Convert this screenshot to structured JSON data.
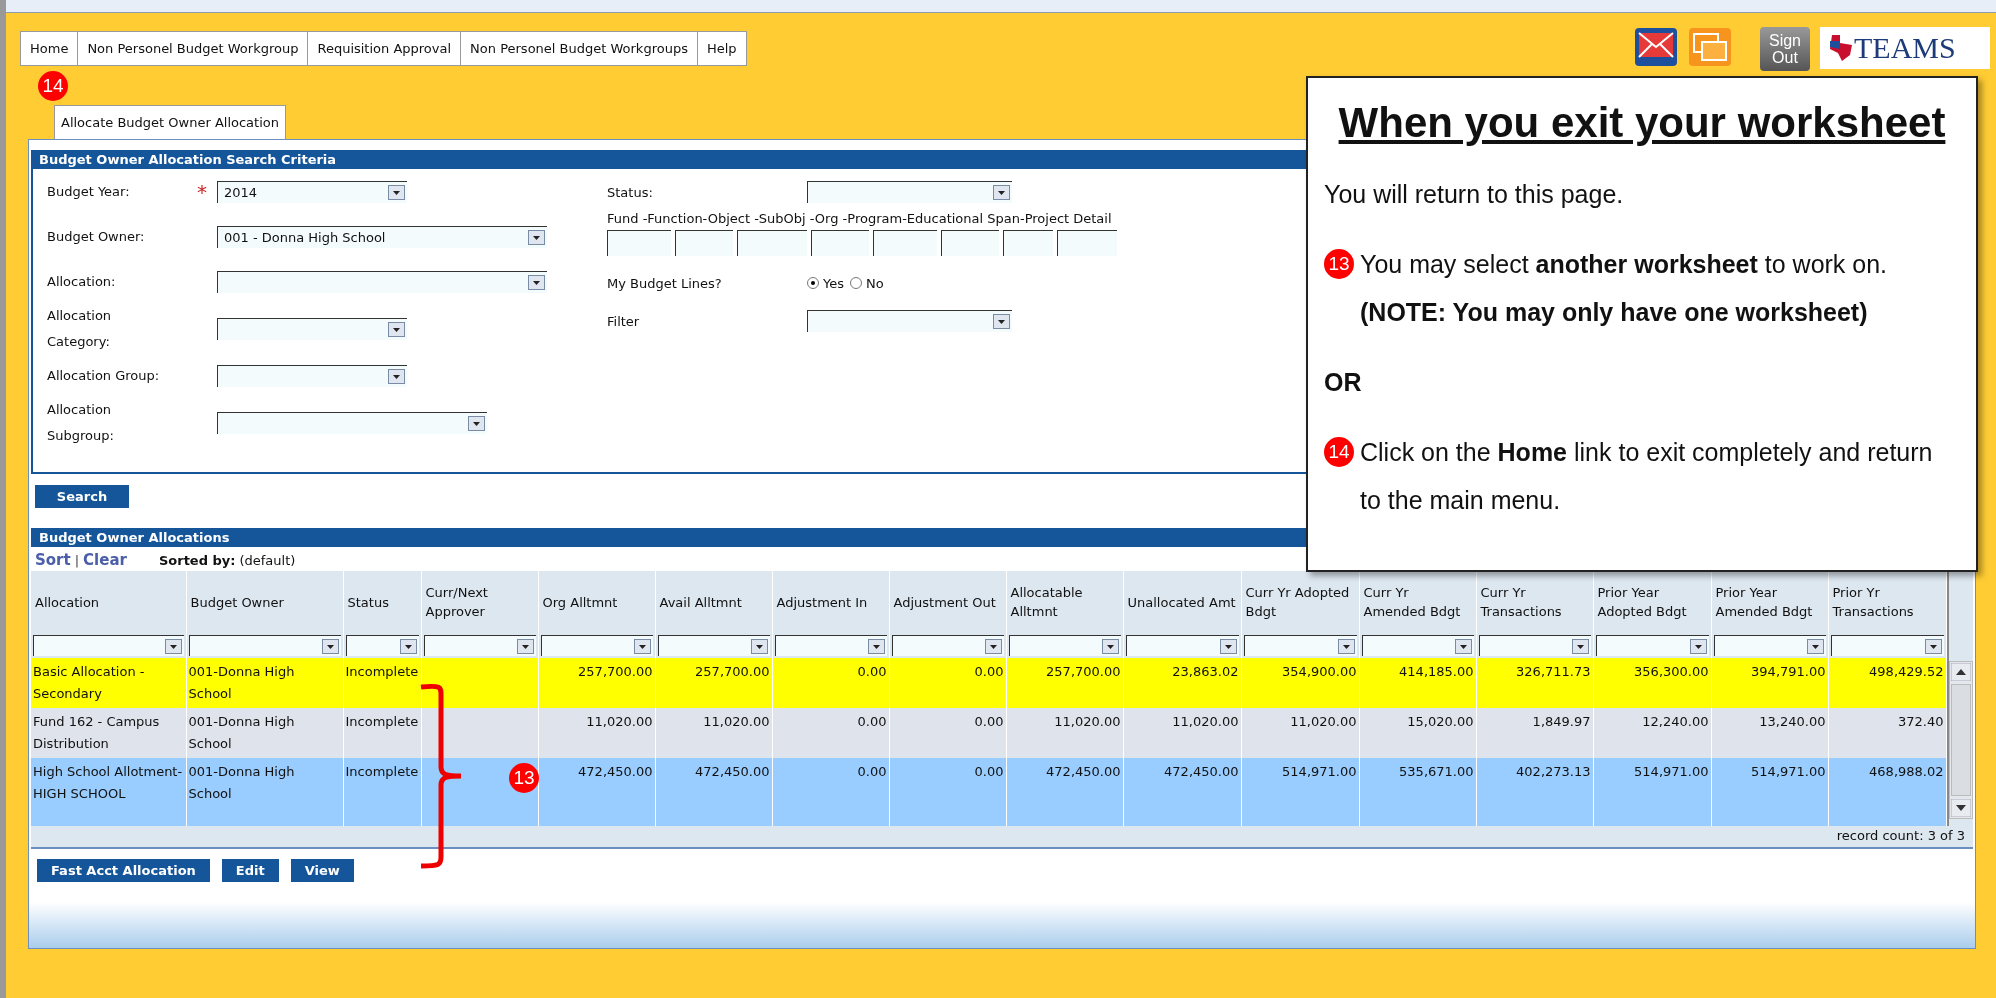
{
  "menu": [
    {
      "label": "Home"
    },
    {
      "label": "Non Personel Budget Workgroup"
    },
    {
      "label": "Requisition Approval"
    },
    {
      "label": "Non Personel Budget Workgroups"
    },
    {
      "label": "Help"
    }
  ],
  "menu_badge": "14",
  "header_buttons": {
    "sign_out": "Sign Out",
    "logo": "TEAMS"
  },
  "tabs": [
    {
      "label": "Allocate Budget Owner Allocation",
      "selected": true
    }
  ],
  "search_criteria": {
    "title": "Budget Owner Allocation Search Criteria",
    "left_fields": [
      {
        "label": "Budget Year:",
        "required": true,
        "value": "2014"
      },
      {
        "label": "Budget Owner:",
        "required": false,
        "value": "001 - Donna High School"
      },
      {
        "label": "Allocation:",
        "required": false
      },
      {
        "label": "Allocation Category:",
        "required": false
      },
      {
        "label": "Allocation Group:",
        "required": false
      },
      {
        "label": "Allocation Subgroup:",
        "required": false
      }
    ],
    "required_mark": "*",
    "status_label": "Status:",
    "account_label": "Fund -Function-Object -SubObj -Org -Program-Educational Span-Project Detail",
    "my_budget_lines": {
      "label": "My Budget Lines?",
      "options": [
        {
          "label": "Yes",
          "selected": true
        },
        {
          "label": "No",
          "selected": false
        }
      ]
    },
    "filter_label": "Filter",
    "search_button": "Search"
  },
  "allocations": {
    "title": "Budget Owner Allocations",
    "sort": "Sort",
    "separator": "|",
    "clear": "Clear",
    "sorted_by_label": "Sorted by:",
    "sorted_by_value": "(default)",
    "columns": [
      "Allocation",
      "Budget Owner",
      "Status",
      "Curr/Next Approver",
      "Org Alltmnt",
      "Avail Alltmnt",
      "Adjustment In",
      "Adjustment Out",
      "Allocatable Alltmnt",
      "Unallocated Amt",
      "Curr Yr Adopted Bdgt",
      "Curr Yr Amended Bdgt",
      "Curr Yr Transactions",
      "Prior Year Adopted Bdgt",
      "Prior Year Amended Bdgt",
      "Prior Yr Transactions"
    ],
    "rows": [
      {
        "selected": true,
        "cells": [
          "Basic Allocation - Secondary",
          "001-Donna High School",
          "Incomplete",
          "",
          "257,700.00",
          "257,700.00",
          "0.00",
          "0.00",
          "257,700.00",
          "23,863.02",
          "354,900.00",
          "414,185.00",
          "326,711.73",
          "356,300.00",
          "394,791.00",
          "498,429.52"
        ]
      },
      {
        "selected": false,
        "cells": [
          "Fund 162 - Campus Distribution",
          "001-Donna High School",
          "Incomplete",
          "",
          "11,020.00",
          "11,020.00",
          "0.00",
          "0.00",
          "11,020.00",
          "11,020.00",
          "11,020.00",
          "15,020.00",
          "1,849.97",
          "12,240.00",
          "13,240.00",
          "372.40"
        ]
      },
      {
        "selected": false,
        "cells": [
          "High School Allotment-HIGH SCHOOL",
          "001-Donna High School",
          "Incomplete",
          "",
          "472,450.00",
          "472,450.00",
          "0.00",
          "0.00",
          "472,450.00",
          "472,450.00",
          "514,971.00",
          "535,671.00",
          "402,273.13",
          "514,971.00",
          "514,971.00",
          "468,988.02"
        ]
      }
    ],
    "record_count": "record count: 3 of 3",
    "bracket_badge": "13"
  },
  "action_buttons": [
    "Fast Acct Allocation",
    "Edit",
    "View"
  ],
  "callout": {
    "title": "When you exit your worksheet",
    "paragraphs": [
      {
        "text": "You will return to this page."
      },
      {
        "badge": "13",
        "text": "You may select **another worksheet** to work on. **(NOTE: You may only have one worksheet)**"
      },
      {
        "text": "**OR**"
      },
      {
        "badge": "14",
        "text": "Click on the **Home** link to exit completely and return to the main menu."
      }
    ]
  }
}
